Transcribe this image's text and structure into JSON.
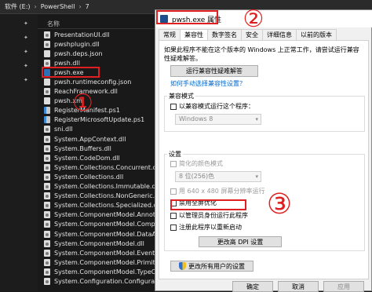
{
  "explorer": {
    "breadcrumb": [
      "软件 (E:)",
      "PowerShell",
      "7"
    ],
    "column_name": "名称",
    "files": [
      {
        "name": "PresentationUI.dll",
        "icon": "gear"
      },
      {
        "name": "pwshplugin.dll",
        "icon": "gear"
      },
      {
        "name": "pwsh.deps.json",
        "icon": "file"
      },
      {
        "name": "pwsh.dll",
        "icon": "gear"
      },
      {
        "name": "pwsh.exe",
        "icon": "ps"
      },
      {
        "name": "pwsh.runtimeconfig.json",
        "icon": "file"
      },
      {
        "name": "ReachFramework.dll",
        "icon": "gear"
      },
      {
        "name": "pwsh.xml",
        "icon": "file"
      },
      {
        "name": "RegisterManifest.ps1",
        "icon": "ps1"
      },
      {
        "name": "RegisterMicrosoftUpdate.ps1",
        "icon": "ps1"
      },
      {
        "name": "sni.dll",
        "icon": "gear"
      },
      {
        "name": "System.AppContext.dll",
        "icon": "gear"
      },
      {
        "name": "System.Buffers.dll",
        "icon": "gear"
      },
      {
        "name": "System.CodeDom.dll",
        "icon": "gear"
      },
      {
        "name": "System.Collections.Concurrent.dll",
        "icon": "gear"
      },
      {
        "name": "System.Collections.dll",
        "icon": "gear"
      },
      {
        "name": "System.Collections.Immutable.dll",
        "icon": "gear"
      },
      {
        "name": "System.Collections.NonGeneric.dll",
        "icon": "gear"
      },
      {
        "name": "System.Collections.Specialized.dll",
        "icon": "gear"
      },
      {
        "name": "System.ComponentModel.Annotation...",
        "icon": "gear"
      },
      {
        "name": "System.ComponentModel.Composition...",
        "icon": "gear"
      },
      {
        "name": "System.ComponentModel.DataAnnot...",
        "icon": "gear"
      },
      {
        "name": "System.ComponentModel.dll",
        "icon": "gear"
      },
      {
        "name": "System.ComponentModel.EventBase...",
        "icon": "gear"
      },
      {
        "name": "System.ComponentModel.Primitives.dll",
        "icon": "gear"
      },
      {
        "name": "System.ComponentModel.TypeConve...",
        "icon": "gear"
      },
      {
        "name": "System.Configuration.Configuration...",
        "icon": "gear"
      }
    ]
  },
  "annotations": {
    "one": "①",
    "two": "②",
    "three": "③"
  },
  "dialog": {
    "title": "pwsh.exe 属性",
    "tabs": [
      "常规",
      "兼容性",
      "数字签名",
      "安全",
      "详细信息",
      "以前的版本"
    ],
    "intro": "如果此程序不能在这个版本的 Windows 上正常工作，请尝试运行兼容性疑难解答。",
    "troubleshoot_button": "运行兼容性疑难解答",
    "manual_link": "如何手动选择兼容性设置？",
    "compat_mode_group": "兼容模式",
    "compat_mode_checkbox": "以兼容模式运行这个程序：",
    "compat_mode_select": "Windows 8",
    "settings_group": "设置",
    "reduced_color_checkbox": "简化的颜色模式",
    "color_select": "8 位(256)色",
    "resolution_checkbox": "用 640 x 480 屏幕分辨率运行",
    "disable_fullscreen_checkbox": "禁用全屏优化",
    "admin_checkbox": "以管理员身份运行此程序",
    "register_restart_checkbox": "注册此程序以重新启动",
    "dpi_button": "更改高 DPI 设置",
    "all_users_button": "更改所有用户的设置",
    "ok_button": "确定",
    "cancel_button": "取消",
    "apply_button": "应用"
  },
  "colors": {
    "accent": "#e02020",
    "link": "#0066cc"
  }
}
